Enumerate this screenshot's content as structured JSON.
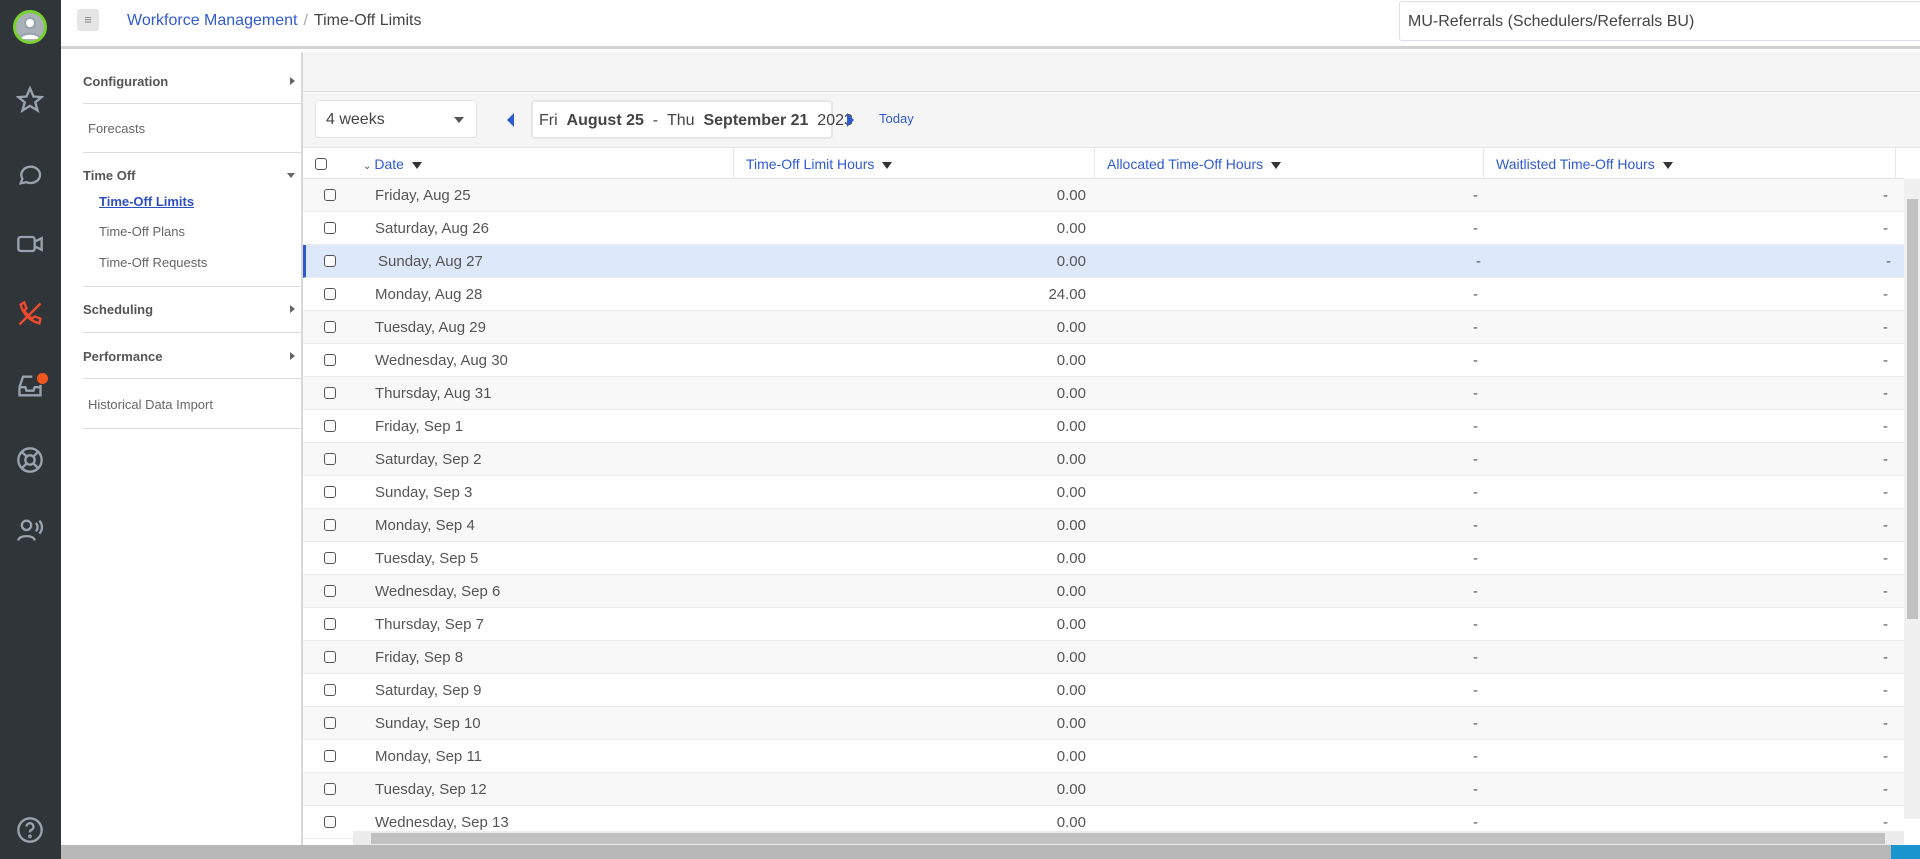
{
  "header": {
    "breadcrumb_parent": "Workforce Management",
    "breadcrumb_sep": "/",
    "breadcrumb_current": "Time-Off Limits",
    "business_unit": "MU-Referrals (Schedulers/Referrals BU)"
  },
  "nav": {
    "configuration": "Configuration",
    "forecasts": "Forecasts",
    "time_off": "Time Off",
    "time_off_limits": "Time-Off Limits",
    "time_off_plans": "Time-Off Plans",
    "time_off_requests": "Time-Off Requests",
    "scheduling": "Scheduling",
    "performance": "Performance",
    "historical": "Historical Data Import"
  },
  "toolbar": {
    "period": "4 weeks",
    "range_start_dow": "Fri",
    "range_start": "August 25",
    "range_dash": "-",
    "range_end_dow": "Thu",
    "range_end": "September 21",
    "range_year": "2023",
    "today": "Today"
  },
  "grid": {
    "columns": [
      "Date",
      "Time-Off Limit Hours",
      "Allocated Time-Off Hours",
      "Waitlisted Time-Off Hours"
    ],
    "rows": [
      {
        "date": "Friday, Aug 25",
        "limit": "0.00",
        "alloc": "-",
        "wait": "-"
      },
      {
        "date": "Saturday, Aug 26",
        "limit": "0.00",
        "alloc": "-",
        "wait": "-"
      },
      {
        "date": "Sunday, Aug 27",
        "limit": "0.00",
        "alloc": "-",
        "wait": "-"
      },
      {
        "date": "Monday, Aug 28",
        "limit": "24.00",
        "alloc": "-",
        "wait": "-"
      },
      {
        "date": "Tuesday, Aug 29",
        "limit": "0.00",
        "alloc": "-",
        "wait": "-"
      },
      {
        "date": "Wednesday, Aug 30",
        "limit": "0.00",
        "alloc": "-",
        "wait": "-"
      },
      {
        "date": "Thursday, Aug 31",
        "limit": "0.00",
        "alloc": "-",
        "wait": "-"
      },
      {
        "date": "Friday, Sep 1",
        "limit": "0.00",
        "alloc": "-",
        "wait": "-"
      },
      {
        "date": "Saturday, Sep 2",
        "limit": "0.00",
        "alloc": "-",
        "wait": "-"
      },
      {
        "date": "Sunday, Sep 3",
        "limit": "0.00",
        "alloc": "-",
        "wait": "-"
      },
      {
        "date": "Monday, Sep 4",
        "limit": "0.00",
        "alloc": "-",
        "wait": "-"
      },
      {
        "date": "Tuesday, Sep 5",
        "limit": "0.00",
        "alloc": "-",
        "wait": "-"
      },
      {
        "date": "Wednesday, Sep 6",
        "limit": "0.00",
        "alloc": "-",
        "wait": "-"
      },
      {
        "date": "Thursday, Sep 7",
        "limit": "0.00",
        "alloc": "-",
        "wait": "-"
      },
      {
        "date": "Friday, Sep 8",
        "limit": "0.00",
        "alloc": "-",
        "wait": "-"
      },
      {
        "date": "Saturday, Sep 9",
        "limit": "0.00",
        "alloc": "-",
        "wait": "-"
      },
      {
        "date": "Sunday, Sep 10",
        "limit": "0.00",
        "alloc": "-",
        "wait": "-"
      },
      {
        "date": "Monday, Sep 11",
        "limit": "0.00",
        "alloc": "-",
        "wait": "-"
      },
      {
        "date": "Tuesday, Sep 12",
        "limit": "0.00",
        "alloc": "-",
        "wait": "-"
      },
      {
        "date": "Wednesday, Sep 13",
        "limit": "0.00",
        "alloc": "-",
        "wait": "-"
      }
    ],
    "selected_index": 2
  }
}
